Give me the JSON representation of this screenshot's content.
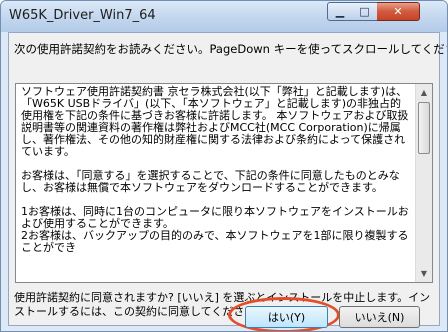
{
  "window": {
    "title": "W65K_Driver_Win7_64",
    "minimize_glyph": "▁",
    "maximize_glyph": "□",
    "close_glyph": "✕"
  },
  "instruction": "次の使用許諾契約をお読みください。PageDown キーを使ってスクロールしてください。",
  "eula": {
    "paragraphs": [
      "ソフトウェア使用許諾契約書 京セラ株式会社(以下「弊社」と記載します)は、「W65K USBドライバ」(以下、「本ソフトウェア」と記載します)の非独占的使用権を下記の条件に基づきお客様に許諾します。 本ソフトウェアおよび取扱説明書等の関連資料の著作権は弊社およびMCC社(MCC Corporation)に帰属し、著作権法、その他の知的財産権に関する法律および条約によって保護されています。",
      "お客様は、「同意する」を選択することで、下記の条件に同意したものとみなし、お客様は無償で本ソフトウェアをダウンロードすることができます。",
      "1お客様は、同時に1台のコンピュータに限り本ソフトウェアをインストールおよび使用することができます。",
      "2お客様は、バックアップの目的のみで、本ソフトウェアを1部に限り複製することができ"
    ],
    "scroll_up_glyph": "▲",
    "scroll_down_glyph": "▼"
  },
  "question": "使用許諾契約に同意されますか? [いいえ] を選ぶとインストールを中止します。インストールするには、この契約に同意してください。",
  "buttons": {
    "yes": "はい(Y)",
    "no": "いいえ(N)"
  },
  "colors": {
    "highlight": "#e34d2a",
    "close_button": "#c7432a"
  }
}
